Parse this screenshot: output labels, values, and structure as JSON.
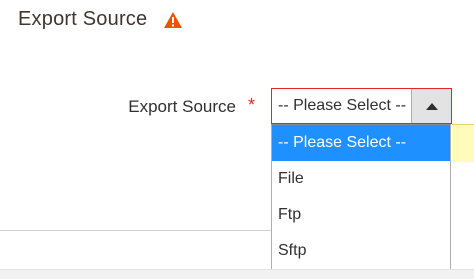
{
  "section": {
    "title": "Export Source",
    "warning_icon": "warning-icon",
    "warning_color": "#eb5202"
  },
  "field": {
    "label": "Export Source",
    "required_marker": "*",
    "selected_value": "-- Please Select --",
    "arrow_icon": "caret-up-icon"
  },
  "dropdown": {
    "options": [
      {
        "label": "-- Please Select --",
        "selected": true
      },
      {
        "label": "File",
        "selected": false
      },
      {
        "label": "Ftp",
        "selected": false
      },
      {
        "label": "Sftp",
        "selected": false
      }
    ],
    "highlight_color": "#1e90ff"
  },
  "colors": {
    "error_border": "#e22626",
    "required": "#e02b27",
    "error_background": "#fffbbb"
  }
}
